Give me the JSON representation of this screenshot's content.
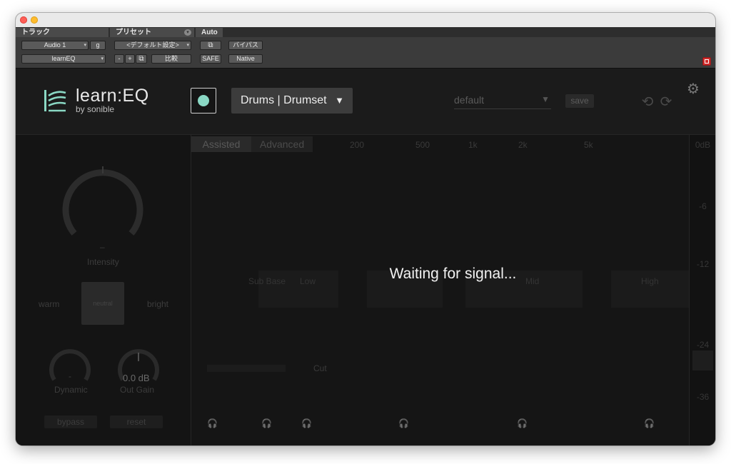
{
  "header": {
    "track_label": "トラック",
    "preset_label": "プリセット",
    "auto_label": "Auto",
    "track_name": "Audio 1",
    "group": "g",
    "insert_name": "learnEQ",
    "preset_value": "<デフォルト設定>",
    "minus": "-",
    "plus": "+",
    "compare": "比較",
    "safe": "SAFE",
    "bypass": "バイパス",
    "native": "Native"
  },
  "plugin": {
    "logo_title": "learn:EQ",
    "logo_by": "by sonible",
    "profile": "Drums | Drumset",
    "preset_name": "default",
    "save": "save",
    "colors": {
      "accent": "#8ad8c4",
      "background": "#161616"
    }
  },
  "sidebar": {
    "intensity_value": "–",
    "intensity_label": "Intensity",
    "warm": "warm",
    "bright": "bright",
    "tone_box_label": "neutral",
    "dynamic_value": "-",
    "dynamic_label": "Dynamic",
    "outgain_value": "0.0 dB",
    "outgain_label": "Out Gain",
    "bypass": "bypass",
    "reset": "reset"
  },
  "eq": {
    "tabs": [
      "Assisted",
      "Advanced"
    ],
    "freq_labels": [
      "200",
      "500",
      "1k",
      "2k",
      "5k"
    ],
    "bands": [
      "Sub Base",
      "Low",
      "Mid",
      "High"
    ],
    "cut_label": "Cut",
    "waiting": "Waiting for signal..."
  },
  "meter": {
    "labels": [
      "0dB",
      "-6",
      "-12",
      "-24",
      "-36"
    ]
  }
}
